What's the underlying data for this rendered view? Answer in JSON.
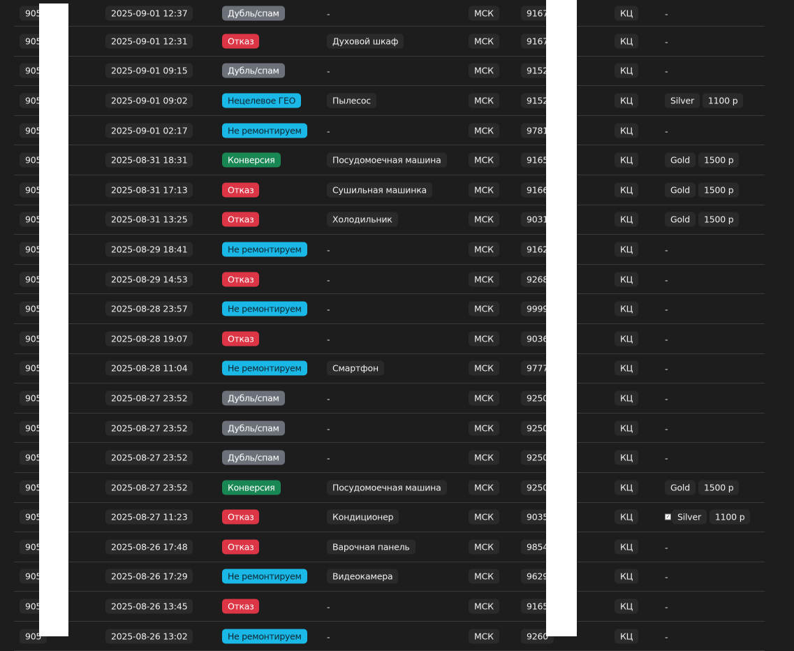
{
  "colors": {
    "background": "#1d1d1d",
    "chip": "#2a2a2a",
    "status_duplicate": "#6b7079",
    "status_refusal": "#dc3545",
    "status_no_repair": "#1ab8e6",
    "status_conversion": "#198754",
    "mask": "#ffffff"
  },
  "rows": [
    {
      "id": "905",
      "datetime": "2025-09-01 12:37",
      "status": "Дубль/спам",
      "status_kind": "gray",
      "product": "-",
      "city": "МСК",
      "phone": "9167",
      "source": "КЦ",
      "tier": "-",
      "price": ""
    },
    {
      "id": "905",
      "datetime": "2025-09-01 12:31",
      "status": "Отказ",
      "status_kind": "red",
      "product": "Духовой шкаф",
      "city": "МСК",
      "phone": "9167",
      "source": "КЦ",
      "tier": "-",
      "price": ""
    },
    {
      "id": "905",
      "datetime": "2025-09-01 09:15",
      "status": "Дубль/спам",
      "status_kind": "gray",
      "product": "-",
      "city": "МСК",
      "phone": "9152",
      "source": "КЦ",
      "tier": "-",
      "price": ""
    },
    {
      "id": "905",
      "datetime": "2025-09-01 09:02",
      "status": "Нецелевое ГЕО",
      "status_kind": "cyan",
      "product": "Пылесос",
      "city": "МСК",
      "phone": "9152",
      "source": "КЦ",
      "tier": "Silver",
      "price": "1100 р"
    },
    {
      "id": "905",
      "datetime": "2025-09-01 02:17",
      "status": "Не ремонтируем",
      "status_kind": "cyan",
      "product": "-",
      "city": "МСК",
      "phone": "9781",
      "source": "КЦ",
      "tier": "-",
      "price": ""
    },
    {
      "id": "905",
      "datetime": "2025-08-31 18:31",
      "status": "Конверсия",
      "status_kind": "green",
      "product": "Посудомоечная машина",
      "city": "МСК",
      "phone": "9165",
      "source": "КЦ",
      "tier": "Gold",
      "price": "1500 р"
    },
    {
      "id": "905",
      "datetime": "2025-08-31 17:13",
      "status": "Отказ",
      "status_kind": "red",
      "product": "Сушильная машинка",
      "city": "МСК",
      "phone": "9166",
      "source": "КЦ",
      "tier": "Gold",
      "price": "1500 р"
    },
    {
      "id": "905",
      "datetime": "2025-08-31 13:25",
      "status": "Отказ",
      "status_kind": "red",
      "product": "Холодильник",
      "city": "МСК",
      "phone": "9031",
      "source": "КЦ",
      "tier": "Gold",
      "price": "1500 р"
    },
    {
      "id": "905",
      "datetime": "2025-08-29 18:41",
      "status": "Не ремонтируем",
      "status_kind": "cyan",
      "product": "-",
      "city": "МСК",
      "phone": "9162",
      "source": "КЦ",
      "tier": "-",
      "price": ""
    },
    {
      "id": "905",
      "datetime": "2025-08-29 14:53",
      "status": "Отказ",
      "status_kind": "red",
      "product": "-",
      "city": "МСК",
      "phone": "9268",
      "source": "КЦ",
      "tier": "-",
      "price": ""
    },
    {
      "id": "905",
      "datetime": "2025-08-28 23:57",
      "status": "Не ремонтируем",
      "status_kind": "cyan",
      "product": "-",
      "city": "МСК",
      "phone": "9999",
      "source": "КЦ",
      "tier": "-",
      "price": ""
    },
    {
      "id": "905",
      "datetime": "2025-08-28 19:07",
      "status": "Отказ",
      "status_kind": "red",
      "product": "-",
      "city": "МСК",
      "phone": "9036",
      "source": "КЦ",
      "tier": "-",
      "price": ""
    },
    {
      "id": "905",
      "datetime": "2025-08-28 11:04",
      "status": "Не ремонтируем",
      "status_kind": "cyan",
      "product": "Смартфон",
      "city": "МСК",
      "phone": "9777",
      "source": "КЦ",
      "tier": "-",
      "price": ""
    },
    {
      "id": "905",
      "datetime": "2025-08-27 23:52",
      "status": "Дубль/спам",
      "status_kind": "gray",
      "product": "-",
      "city": "МСК",
      "phone": "9250",
      "source": "КЦ",
      "tier": "-",
      "price": ""
    },
    {
      "id": "905",
      "datetime": "2025-08-27 23:52",
      "status": "Дубль/спам",
      "status_kind": "gray",
      "product": "-",
      "city": "МСК",
      "phone": "9250",
      "source": "КЦ",
      "tier": "-",
      "price": ""
    },
    {
      "id": "905",
      "datetime": "2025-08-27 23:52",
      "status": "Дубль/спам",
      "status_kind": "gray",
      "product": "-",
      "city": "МСК",
      "phone": "9250",
      "source": "КЦ",
      "tier": "-",
      "price": ""
    },
    {
      "id": "905",
      "datetime": "2025-08-27 23:52",
      "status": "Конверсия",
      "status_kind": "green",
      "product": "Посудомоечная машина",
      "city": "МСК",
      "phone": "9250",
      "source": "КЦ",
      "tier": "Gold",
      "price": "1500 р"
    },
    {
      "id": "905",
      "datetime": "2025-08-27 11:23",
      "status": "Отказ",
      "status_kind": "red",
      "product": "Кондиционер",
      "city": "МСК",
      "phone": "9035",
      "source": "КЦ",
      "tier": "Silver",
      "price": "1100 р",
      "checked": true
    },
    {
      "id": "905",
      "datetime": "2025-08-26 17:48",
      "status": "Отказ",
      "status_kind": "red",
      "product": "Варочная панель",
      "city": "МСК",
      "phone": "9854",
      "source": "КЦ",
      "tier": "-",
      "price": ""
    },
    {
      "id": "905",
      "datetime": "2025-08-26 17:29",
      "status": "Не ремонтируем",
      "status_kind": "cyan",
      "product": "Видеокамера",
      "city": "МСК",
      "phone": "9629",
      "source": "КЦ",
      "tier": "-",
      "price": ""
    },
    {
      "id": "905",
      "datetime": "2025-08-26 13:45",
      "status": "Отказ",
      "status_kind": "red",
      "product": "-",
      "city": "МСК",
      "phone": "9165",
      "source": "КЦ",
      "tier": "-",
      "price": ""
    },
    {
      "id": "905",
      "datetime": "2025-08-26 13:02",
      "status": "Не ремонтируем",
      "status_kind": "cyan",
      "product": "-",
      "city": "МСК",
      "phone": "9260",
      "source": "КЦ",
      "tier": "-",
      "price": ""
    }
  ]
}
